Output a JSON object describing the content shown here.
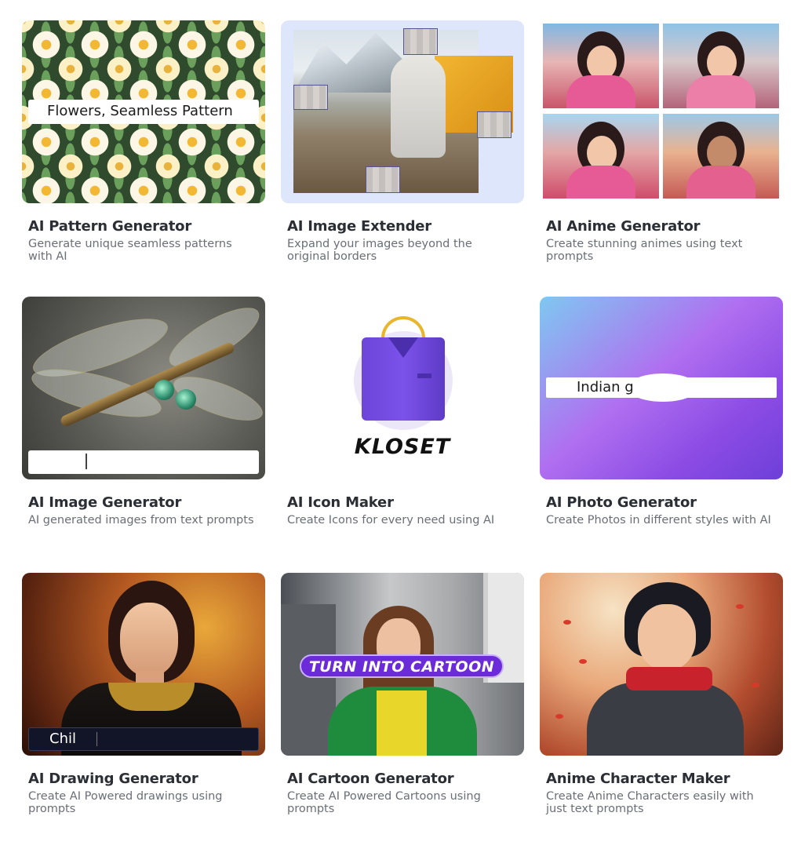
{
  "cards": [
    {
      "title": "AI Pattern Generator",
      "description": "Generate unique seamless patterns with AI",
      "preview_text": "Flowers, Seamless Pattern"
    },
    {
      "title": "AI Image Extender",
      "description": "Expand your images beyond the original borders"
    },
    {
      "title": "AI Anime Generator",
      "description": "Create stunning animes using text prompts"
    },
    {
      "title": "AI Image Generator",
      "description": "AI generated images from text prompts"
    },
    {
      "title": "AI Icon Maker",
      "description": "Create Icons for every need using AI",
      "preview_text": "KLOSET"
    },
    {
      "title": "AI Photo Generator",
      "description": "Create Photos in different styles with AI",
      "preview_text": "Indian g"
    },
    {
      "title": "AI Drawing Generator",
      "description": "Create AI Powered drawings using prompts",
      "preview_text": "Chil"
    },
    {
      "title": "AI Cartoon Generator",
      "description": "Create AI Powered Cartoons using prompts",
      "preview_text": "TURN INTO CARTOON"
    },
    {
      "title": "Anime Character Maker",
      "description": "Create Anime Characters easily with just text prompts"
    }
  ],
  "colors": {
    "title": "#2c2e36",
    "description": "#6b6e78",
    "photo_gradient_start": "#7fc8f1",
    "photo_gradient_end": "#6d3fd9",
    "cartoon_badge": "#6c2bd9"
  }
}
